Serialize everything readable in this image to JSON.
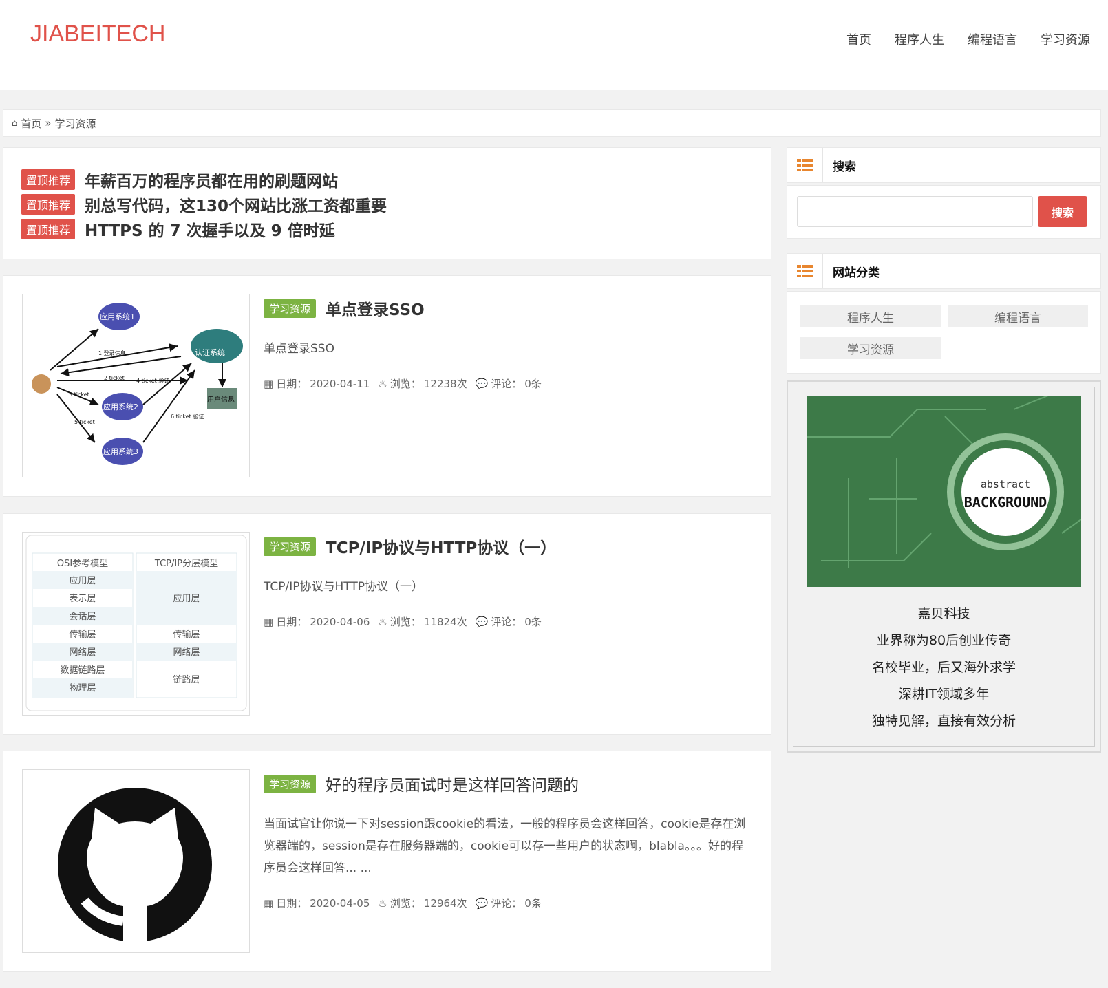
{
  "header": {
    "logo": "JIABEITECH",
    "nav": [
      "首页",
      "程序人生",
      "编程语言",
      "学习资源"
    ]
  },
  "breadcrumb": {
    "home": "首页",
    "sep": "»",
    "current": "学习资源"
  },
  "top_posts": {
    "tag": "置顶推荐",
    "items": [
      "年薪百万的程序员都在用的刷题网站",
      "别总写代码，这130个网站比涨工资都重要",
      "HTTPS 的 7 次握手以及 9 倍时延"
    ]
  },
  "posts": [
    {
      "tag": "学习资源",
      "title": "单点登录SSO",
      "excerpt": "单点登录SSO",
      "date_label": "日期：",
      "date": "2020-04-11",
      "views_label": "浏览：",
      "views": "12238次",
      "comments_label": "评论：",
      "comments": "0条"
    },
    {
      "tag": "学习资源",
      "title": "TCP/IP协议与HTTP协议（一）",
      "excerpt": "TCP/IP协议与HTTP协议（一）",
      "date_label": "日期：",
      "date": "2020-04-06",
      "views_label": "浏览：",
      "views": "11824次",
      "comments_label": "评论：",
      "comments": "0条"
    },
    {
      "tag": "学习资源",
      "title": "好的程序员面试时是这样回答问题的",
      "excerpt": "当面试官让你说一下对session跟cookie的看法，一般的程序员会这样回答，cookie是存在浏览器端的，session是存在服务器端的，cookie可以存一些用户的状态啊，blabla。。。好的程序员会这样回答... ...",
      "date_label": "日期：",
      "date": "2020-04-05",
      "views_label": "浏览：",
      "views": "12964次",
      "comments_label": "评论：",
      "comments": "0条"
    }
  ],
  "sso_diagram": {
    "nodes": [
      "应用系统1",
      "认证系统",
      "应用系统2",
      "应用系统3",
      "用户信息"
    ],
    "labels": [
      "1 登录信息",
      "2 ticket",
      "3 ticket",
      "4 ticket 验证",
      "5 ticket",
      "6 ticket 验证"
    ]
  },
  "osi_table": {
    "left_header": "OSI参考模型",
    "right_header": "TCP/IP分层模型",
    "left": [
      "应用层",
      "表示层",
      "会话层",
      "传输层",
      "网络层",
      "数据链路层",
      "物理层"
    ],
    "right": [
      "应用层",
      "传输层",
      "网络层",
      "链路层"
    ]
  },
  "sidebar": {
    "search": {
      "title": "搜索",
      "button": "搜索",
      "value": ""
    },
    "categories": {
      "title": "网站分类",
      "items": [
        "程序人生",
        "编程语言",
        "学习资源"
      ]
    },
    "ad": {
      "image_small": "abstract",
      "image_big": "BACKGROUND",
      "lines": [
        "嘉贝科技",
        "业界称为80后创业传奇",
        "名校毕业，后又海外求学",
        "深耕IT领域多年",
        "独特见解，直接有效分析"
      ]
    }
  },
  "colors": {
    "brand": "#e0524a",
    "tag_green": "#7cb342",
    "icon_orange": "#e8862f"
  }
}
